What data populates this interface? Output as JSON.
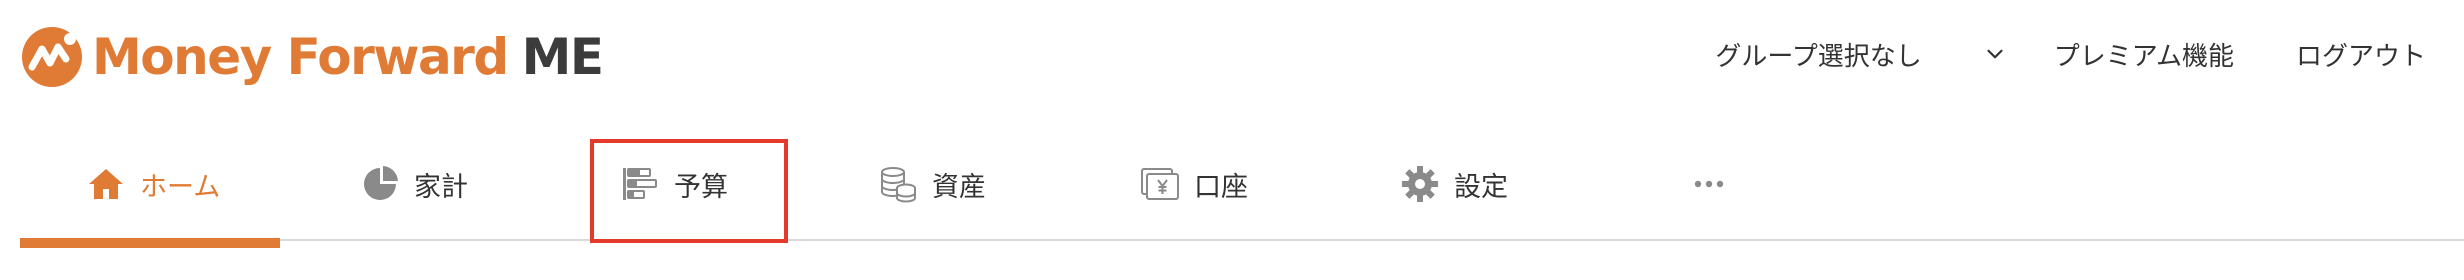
{
  "logo": {
    "brand": "Money Forward",
    "suffix": "ME"
  },
  "header": {
    "group_select": "グループ選択なし",
    "premium": "プレミアム機能",
    "logout": "ログアウト"
  },
  "nav": {
    "tabs": [
      {
        "label": "ホーム",
        "icon": "home-icon",
        "active": true
      },
      {
        "label": "家計",
        "icon": "pie-chart-icon",
        "active": false
      },
      {
        "label": "予算",
        "icon": "budget-bars-icon",
        "active": false
      },
      {
        "label": "資産",
        "icon": "coins-icon",
        "active": false
      },
      {
        "label": "口座",
        "icon": "yen-card-icon",
        "active": false
      },
      {
        "label": "設定",
        "icon": "gear-icon",
        "active": false
      }
    ],
    "more_icon": "more-dots-icon",
    "highlighted_tab": "予算"
  },
  "colors": {
    "brand_orange": "#e07b36",
    "highlight_red": "#e43a2c",
    "icon_gray": "#8a8a8a",
    "text": "#333333"
  }
}
